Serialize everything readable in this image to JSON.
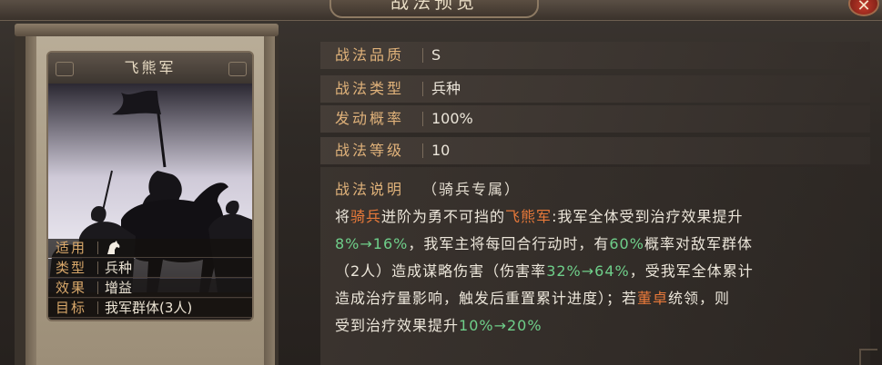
{
  "window": {
    "title": "战法预览",
    "close_label": "✕"
  },
  "card": {
    "name": "飞熊军",
    "info": [
      {
        "label": "适用",
        "value": "",
        "icon": "horse-icon"
      },
      {
        "label": "类型",
        "value": "兵种"
      },
      {
        "label": "效果",
        "value": "增益"
      },
      {
        "label": "目标",
        "value": "我军群体(3人)"
      }
    ]
  },
  "details": [
    {
      "label": "战法品质",
      "value": "S"
    },
    {
      "label": "战法类型",
      "value": "兵种"
    },
    {
      "label": "发动概率",
      "value": "100%"
    },
    {
      "label": "战法等级",
      "value": "10"
    }
  ],
  "description": {
    "label": "战法说明",
    "subtitle": "（骑兵专属）",
    "lines": [
      [
        {
          "t": "将",
          "c": ""
        },
        {
          "t": "骑兵",
          "c": "orange"
        },
        {
          "t": "迸阶为勇不可挡的",
          "c": ""
        },
        {
          "t": "飞熊军",
          "c": "orange"
        },
        {
          "t": ":我军全体受到治疗效果提升",
          "c": ""
        }
      ],
      [
        {
          "t": "8%→16%",
          "c": "green"
        },
        {
          "t": "，我军主将每回合行动时，有",
          "c": ""
        },
        {
          "t": "60%",
          "c": "green"
        },
        {
          "t": "概率对敌军群体",
          "c": ""
        }
      ],
      [
        {
          "t": "（2人）造成谋略伤害（伤害率",
          "c": ""
        },
        {
          "t": "32%→64%",
          "c": "green"
        },
        {
          "t": "，受我军全体累计",
          "c": ""
        }
      ],
      [
        {
          "t": "造成治疗量影响，触发后重置累计进度）；若",
          "c": ""
        },
        {
          "t": "董卓",
          "c": "orange"
        },
        {
          "t": "统领，则",
          "c": ""
        }
      ],
      [
        {
          "t": "受到治疗效果提升",
          "c": ""
        },
        {
          "t": "10%→20%",
          "c": "green"
        }
      ]
    ]
  },
  "colors": {
    "label_gold": "#e0b27a",
    "highlight_orange": "#e8793a",
    "highlight_green": "#6fcf8a"
  }
}
